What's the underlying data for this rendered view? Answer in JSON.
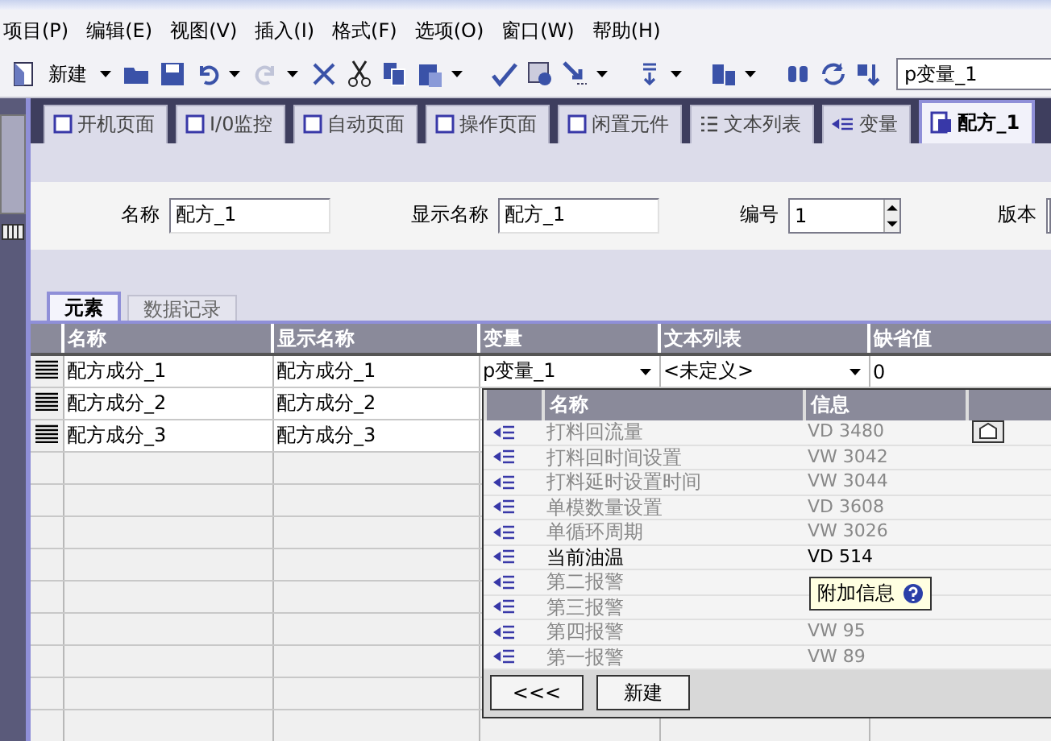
{
  "menu": [
    "项目(P)",
    "编辑(E)",
    "视图(V)",
    "插入(I)",
    "格式(F)",
    "选项(O)",
    "窗口(W)",
    "帮助(H)"
  ],
  "toolbar": {
    "new_label": "新建",
    "search_value": "p变量_1"
  },
  "doc_tabs": [
    {
      "label": "开机页面",
      "kind": "screen",
      "selected": false
    },
    {
      "label": "I/0监控",
      "kind": "screen",
      "selected": false
    },
    {
      "label": "自动页面",
      "kind": "screen",
      "selected": false
    },
    {
      "label": "操作页面",
      "kind": "screen",
      "selected": false
    },
    {
      "label": "闲置元件",
      "kind": "screen",
      "selected": false
    },
    {
      "label": "文本列表",
      "kind": "textlist",
      "selected": false
    },
    {
      "label": "变量",
      "kind": "tag",
      "selected": false
    },
    {
      "label": "配方_1",
      "kind": "recipe",
      "selected": true
    }
  ],
  "properties": [
    {
      "label": "名称",
      "value": "配方_1",
      "kind": "text"
    },
    {
      "label": "显示名称",
      "value": "配方_1",
      "kind": "text"
    },
    {
      "label": "编号",
      "value": "1",
      "kind": "spinner"
    },
    {
      "label": "版本",
      "kind": "cut"
    }
  ],
  "sub_tabs": [
    {
      "label": "元素",
      "selected": true
    },
    {
      "label": "数据记录",
      "selected": false
    }
  ],
  "table": {
    "columns": [
      "名称",
      "显示名称",
      "变量",
      "文本列表",
      "缺省值"
    ],
    "rows": [
      {
        "name": "配方成分_1",
        "display_name": "配方成分_1",
        "tag": "p变量_1",
        "text_list": "<未定义>",
        "default": "0"
      },
      {
        "name": "配方成分_2",
        "display_name": "配方成分_2"
      },
      {
        "name": "配方成分_3",
        "display_name": "配方成分_3"
      }
    ]
  },
  "tag_popup": {
    "columns": [
      "名称",
      "信息"
    ],
    "rows": [
      {
        "name": "打料回流量",
        "info": "VD 3480",
        "selected": false
      },
      {
        "name": "打料回时间设置",
        "info": "VW 3042",
        "selected": false
      },
      {
        "name": "打料延时设置时间",
        "info": "VW 3044",
        "selected": false
      },
      {
        "name": "单模数量设置",
        "info": "VD 3608",
        "selected": false
      },
      {
        "name": "单循环周期",
        "info": "VW 3026",
        "selected": false
      },
      {
        "name": "当前油温",
        "info": "VD 514",
        "selected": true
      },
      {
        "name": "第二报警",
        "selected": false
      },
      {
        "name": "第三报警",
        "selected": false
      },
      {
        "name": "第四报警",
        "info": "VW 95",
        "selected": false
      },
      {
        "name": "第一报警",
        "info": "VW 89",
        "selected": false
      }
    ],
    "tooltip": "附加信息",
    "buttons": [
      "<<<",
      "新建"
    ]
  }
}
